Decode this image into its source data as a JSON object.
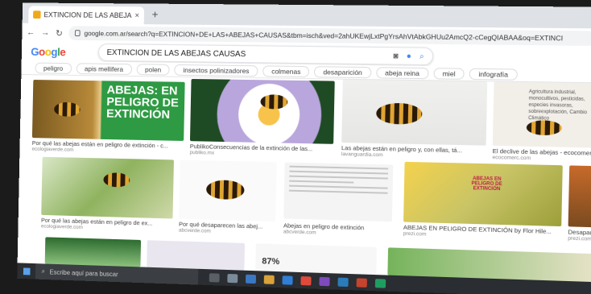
{
  "browser": {
    "tab_title": "EXTINCION DE LAS ABEJAS CAUS",
    "url": "google.com.ar/search?q=EXTINCION+DE+LAS+ABEJAS+CAUSAS&tbm=isch&ved=2ahUKEwjLxtPgYrsAhVtAbkGHUu2AmcQ2-cCegQIABAA&oq=EXTINCI"
  },
  "google": {
    "logo_parts": [
      "G",
      "o",
      "o",
      "g",
      "l",
      "e"
    ],
    "query": "EXTINCION DE LAS ABEJAS CAUSAS"
  },
  "chips": [
    "peligro",
    "apis mellifera",
    "polen",
    "insectos polinizadores",
    "colmenas",
    "desaparición",
    "abeja reina",
    "miel",
    "infografía"
  ],
  "results": [
    {
      "caption": "Por qué las abejas están en peligro de extinción - c...",
      "source": "ecologiaverde.com",
      "banner": "ABEJAS: EN PELIGRO DE EXTINCIÓN"
    },
    {
      "caption": "PublikoConsecuencias de la extinción de las...",
      "source": "publiko.mx"
    },
    {
      "caption": "Las abejas están en peligro y, con ellas, tá...",
      "source": "lavanguardia.com"
    },
    {
      "caption": "El declive de las abejas - ecocomerc...",
      "source": "ecocomerc.com",
      "text": "Agricultura industrial, monocultivos, pesticidas, especies invasoras, sobreexplotación, Cambio Climático"
    },
    {
      "caption": "Por qué las abejas están en peligro de ex...",
      "source": "ecologiaverde.com"
    },
    {
      "caption": "Por qué desaparecen las abej...",
      "source": "abcverde.com"
    },
    {
      "caption": "Abejas en peligro de extinción",
      "source": "abcverde.com"
    },
    {
      "caption": "ABEJAS EN PELIGRO DE EXTINCIÓN by Flor Hile...",
      "source": "prezi.com",
      "title": "ABEJAS EN PELIGRO DE EXTINCIÓN"
    },
    {
      "caption": "Desaparic...",
      "source": "prezi.com"
    },
    {
      "caption": "",
      "source": ""
    },
    {
      "caption": "",
      "source": ""
    },
    {
      "caption": "87%",
      "source": ""
    },
    {
      "caption": "",
      "source": ""
    }
  ],
  "taskbar": {
    "search_placeholder": "Escribe aquí para buscar"
  }
}
